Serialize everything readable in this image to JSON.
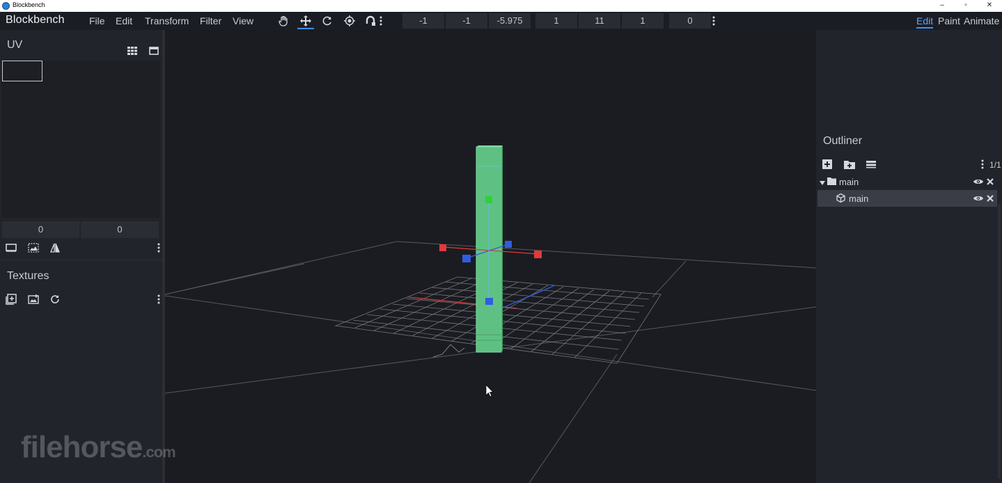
{
  "window": {
    "title": "Blockbench",
    "minimize": "–",
    "maximize": "▫",
    "close": "✕"
  },
  "menubar": {
    "brand": "Blockbench",
    "menus": [
      "File",
      "Edit",
      "Transform",
      "Filter",
      "View"
    ],
    "tools": [
      "hand-tool-icon",
      "move-tool-icon",
      "rotate-tool-icon",
      "pivot-tool-icon",
      "vertex-snap-icon"
    ],
    "position": [
      "-1",
      "-1",
      "-5.975"
    ],
    "size": [
      "1",
      "11",
      "1"
    ],
    "inflate": "0",
    "modes": [
      "Edit",
      "Paint",
      "Animate"
    ],
    "active_mode": "Edit"
  },
  "uv_panel": {
    "title": "UV",
    "size_fields": [
      "0",
      "0"
    ]
  },
  "textures_panel": {
    "title": "Textures"
  },
  "outliner": {
    "title": "Outliner",
    "counter": "1/1",
    "items": [
      {
        "label": "main",
        "type": "group"
      },
      {
        "label": "main",
        "type": "cube"
      }
    ]
  },
  "watermark": {
    "text": "filehorse",
    "suffix": ".com"
  },
  "colors": {
    "accent": "#3e90ff",
    "cube": "#5ec183",
    "axis_x": "#e23a3a",
    "axis_z": "#2f5de0",
    "axis_y": "#2fcf3a"
  }
}
